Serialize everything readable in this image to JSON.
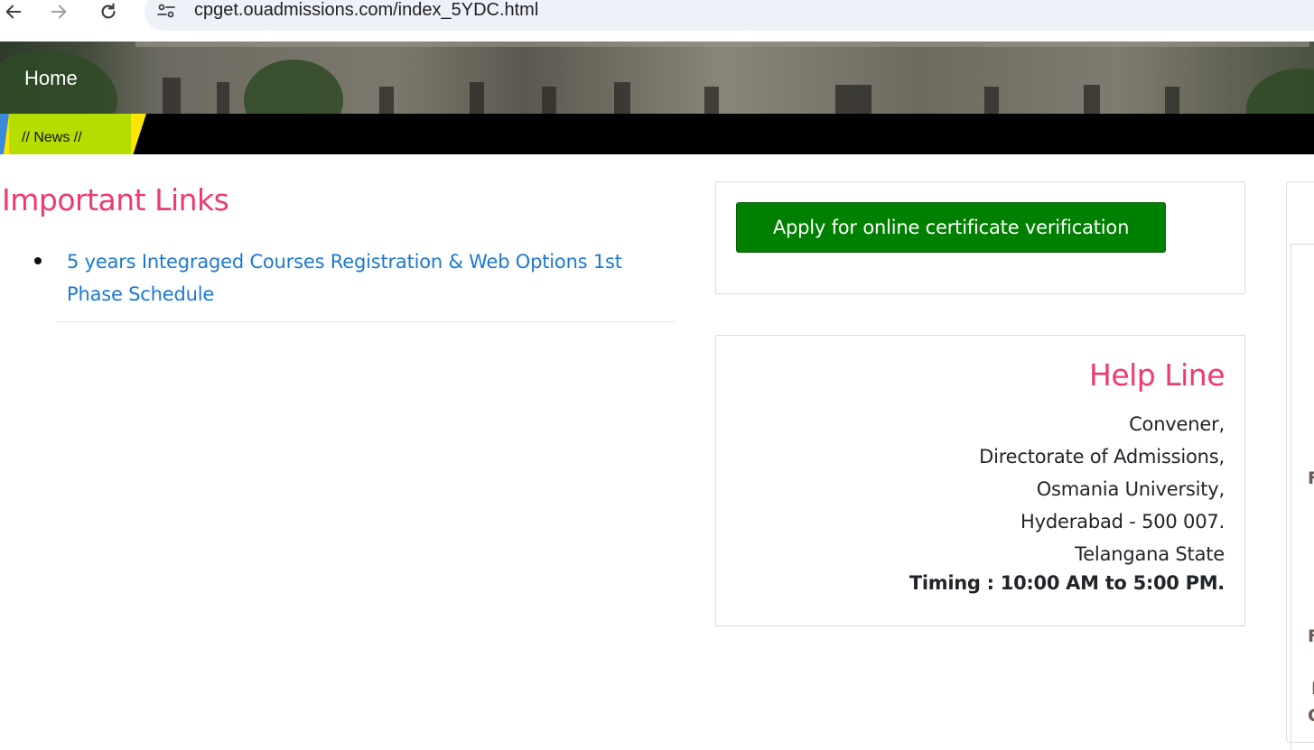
{
  "browser": {
    "url": "cpget.ouadmissions.com/index_5YDC.html"
  },
  "nav": {
    "home_label": "Home"
  },
  "news": {
    "label": "// News //"
  },
  "important_links": {
    "heading": "Important Links",
    "items": [
      {
        "label": "5 years Integraged Courses Registration & Web Options 1st Phase Schedule"
      }
    ]
  },
  "apply": {
    "button_label": "Apply for online certificate verification"
  },
  "helpline": {
    "title": "Help Line",
    "lines": [
      "Convener,",
      "Directorate of Admissions,",
      "Osmania University,",
      "Hyderabad - 500 007.",
      "Telangana State"
    ],
    "timing": "Timing : 10:00 AM to 5:00 PM."
  },
  "right_panel": {
    "edge_chars": [
      "F",
      "F",
      "I",
      "C"
    ]
  },
  "colors": {
    "accent_pink": "#ef3a6f",
    "link_blue": "#1a78d4",
    "button_green": "#008000",
    "news_green": "#b6dd00",
    "news_yellow": "#ffe600"
  }
}
